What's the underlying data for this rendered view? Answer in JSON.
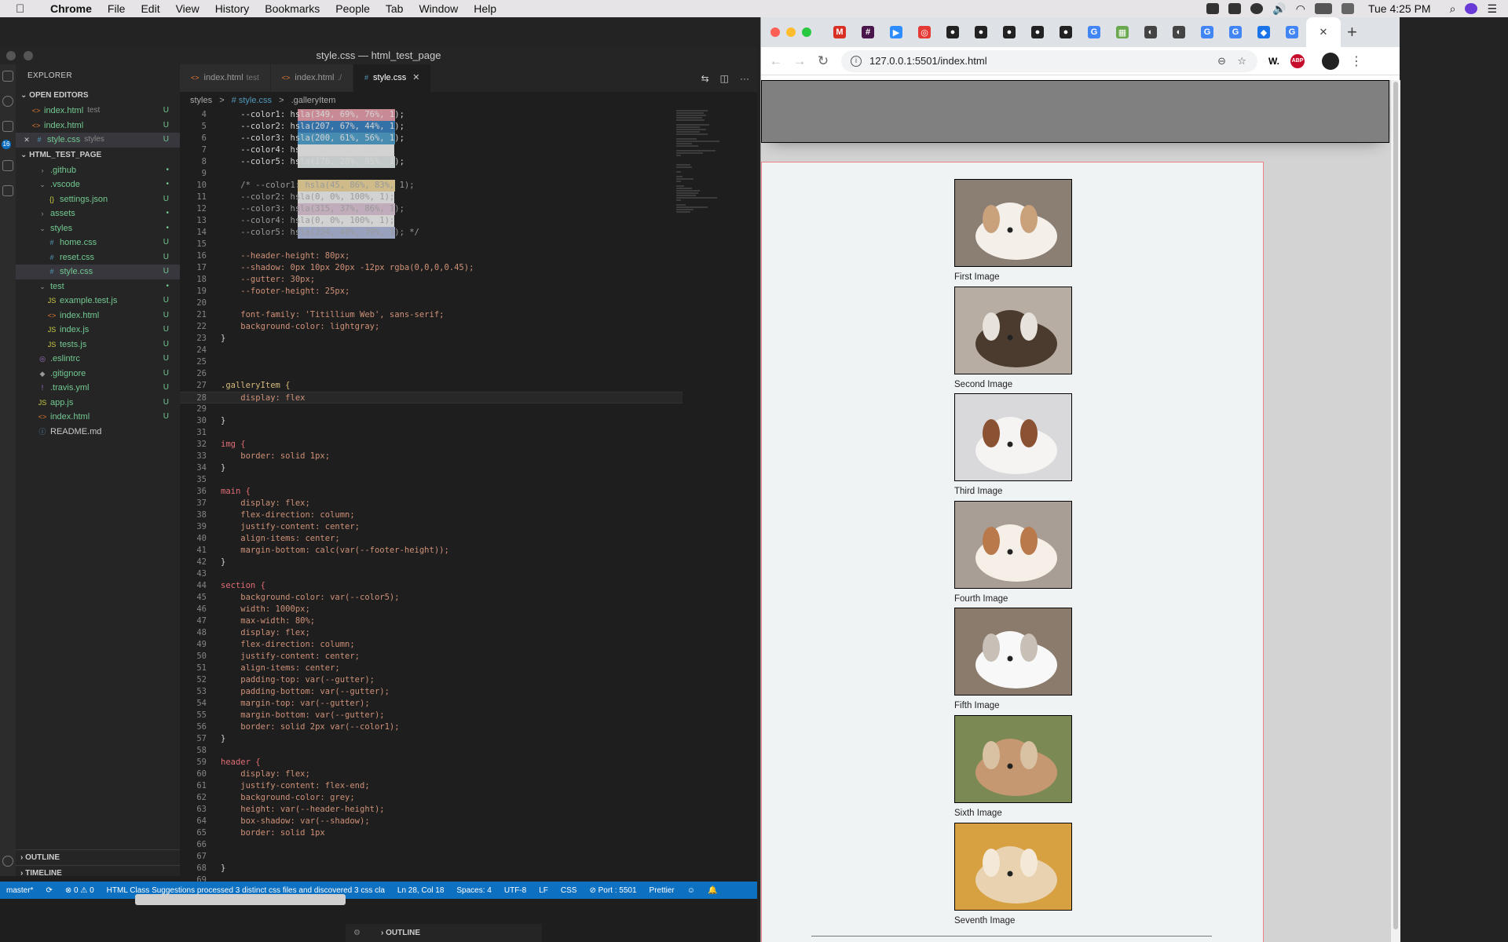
{
  "menubar": {
    "app": "Chrome",
    "items": [
      "File",
      "Edit",
      "View",
      "History",
      "Bookmarks",
      "People",
      "Tab",
      "Window",
      "Help"
    ],
    "clock": "Tue 4:25 PM"
  },
  "vscode": {
    "window_title": "style.css — html_test_page",
    "explorer_label": "EXPLORER",
    "open_editors_label": "OPEN EDITORS",
    "open_editors": [
      {
        "name": "index.html",
        "desc": "test",
        "git": "U"
      },
      {
        "name": "index.html",
        "desc": "",
        "git": "U"
      },
      {
        "name": "style.css",
        "desc": "styles",
        "git": "U"
      }
    ],
    "project_label": "HTML_TEST_PAGE",
    "tree": [
      {
        "name": ".github",
        "kind": "folder",
        "git": "•"
      },
      {
        "name": ".vscode",
        "kind": "folder-open",
        "git": "•"
      },
      {
        "name": "settings.json",
        "kind": "json",
        "git": "U"
      },
      {
        "name": "assets",
        "kind": "folder",
        "git": "•"
      },
      {
        "name": "styles",
        "kind": "folder-open",
        "git": "•"
      },
      {
        "name": "home.css",
        "kind": "css",
        "git": "U"
      },
      {
        "name": "reset.css",
        "kind": "css",
        "git": "U"
      },
      {
        "name": "style.css",
        "kind": "css",
        "git": "U"
      },
      {
        "name": "test",
        "kind": "folder-open",
        "git": "•"
      },
      {
        "name": "example.test.js",
        "kind": "js",
        "git": "U"
      },
      {
        "name": "index.html",
        "kind": "html",
        "git": "U"
      },
      {
        "name": "index.js",
        "kind": "js",
        "git": "U"
      },
      {
        "name": "tests.js",
        "kind": "js",
        "git": "U"
      },
      {
        "name": ".eslintrc",
        "kind": "eslint",
        "git": "U"
      },
      {
        "name": ".gitignore",
        "kind": "git",
        "git": "U"
      },
      {
        "name": ".travis.yml",
        "kind": "yml",
        "git": "U"
      },
      {
        "name": "app.js",
        "kind": "js",
        "git": "U"
      },
      {
        "name": "index.html",
        "kind": "html",
        "git": "U"
      },
      {
        "name": "README.md",
        "kind": "md",
        "git": ""
      }
    ],
    "outline_label": "OUTLINE",
    "timeline_label": "TIMELINE",
    "tabs": [
      {
        "name": "index.html",
        "desc": "test",
        "active": false
      },
      {
        "name": "index.html",
        "desc": "./",
        "active": false
      },
      {
        "name": "style.css",
        "desc": "",
        "active": true
      }
    ],
    "breadcrumb": [
      "styles",
      ">",
      "# style.css",
      ">",
      ".galleryItem"
    ],
    "code_lines": [
      {
        "n": "4",
        "t": "    --color1: hsla(349, 69%, 76%, 1);"
      },
      {
        "n": "5",
        "t": "    --color2: hsla(207, 67%, 44%, 1);"
      },
      {
        "n": "6",
        "t": "    --color3: hsla(200, 61%, 56%, 1);"
      },
      {
        "n": "7",
        "t": "    --color4: hsla(0, 0%, 100%, 1);"
      },
      {
        "n": "8",
        "t": "    --color5: hsla(176, 20%, 95%, 1);"
      },
      {
        "n": "9",
        "t": ""
      },
      {
        "n": "10",
        "t": "    /* --color1: hsla(45, 86%, 83%, 1);"
      },
      {
        "n": "11",
        "t": "    --color2: hsla(0, 0%, 100%, 1);"
      },
      {
        "n": "12",
        "t": "    --color3: hsla(315, 37%, 86%, 1);"
      },
      {
        "n": "13",
        "t": "    --color4: hsla(0, 0%, 100%, 1);"
      },
      {
        "n": "14",
        "t": "    --color5: hsla(224, 40%, 79%, 1); */"
      },
      {
        "n": "15",
        "t": ""
      },
      {
        "n": "16",
        "t": "    --header-height: 80px;"
      },
      {
        "n": "17",
        "t": "    --shadow: 0px 10px 20px -12px rgba(0,0,0,0.45);"
      },
      {
        "n": "18",
        "t": "    --gutter: 30px;"
      },
      {
        "n": "19",
        "t": "    --footer-height: 25px;"
      },
      {
        "n": "20",
        "t": ""
      },
      {
        "n": "21",
        "t": "    font-family: 'Titillium Web', sans-serif;"
      },
      {
        "n": "22",
        "t": "    background-color: lightgray;"
      },
      {
        "n": "23",
        "t": "}"
      },
      {
        "n": "24",
        "t": ""
      },
      {
        "n": "25",
        "t": ""
      },
      {
        "n": "26",
        "t": ""
      },
      {
        "n": "27",
        "t": ".galleryItem {"
      },
      {
        "n": "28",
        "t": "    display: flex"
      },
      {
        "n": "29",
        "t": ""
      },
      {
        "n": "30",
        "t": "}"
      },
      {
        "n": "31",
        "t": ""
      },
      {
        "n": "32",
        "t": "img {"
      },
      {
        "n": "33",
        "t": "    border: solid 1px;"
      },
      {
        "n": "34",
        "t": "}"
      },
      {
        "n": "35",
        "t": ""
      },
      {
        "n": "36",
        "t": "main {"
      },
      {
        "n": "37",
        "t": "    display: flex;"
      },
      {
        "n": "38",
        "t": "    flex-direction: column;"
      },
      {
        "n": "39",
        "t": "    justify-content: center;"
      },
      {
        "n": "40",
        "t": "    align-items: center;"
      },
      {
        "n": "41",
        "t": "    margin-bottom: calc(var(--footer-height));"
      },
      {
        "n": "42",
        "t": "}"
      },
      {
        "n": "43",
        "t": ""
      },
      {
        "n": "44",
        "t": "section {"
      },
      {
        "n": "45",
        "t": "    background-color: var(--color5);"
      },
      {
        "n": "46",
        "t": "    width: 1000px;"
      },
      {
        "n": "47",
        "t": "    max-width: 80%;"
      },
      {
        "n": "48",
        "t": "    display: flex;"
      },
      {
        "n": "49",
        "t": "    flex-direction: column;"
      },
      {
        "n": "50",
        "t": "    justify-content: center;"
      },
      {
        "n": "51",
        "t": "    align-items: center;"
      },
      {
        "n": "52",
        "t": "    padding-top: var(--gutter);"
      },
      {
        "n": "53",
        "t": "    padding-bottom: var(--gutter);"
      },
      {
        "n": "54",
        "t": "    margin-top: var(--gutter);"
      },
      {
        "n": "55",
        "t": "    margin-bottom: var(--gutter);"
      },
      {
        "n": "56",
        "t": "    border: solid 2px var(--color1);"
      },
      {
        "n": "57",
        "t": "}"
      },
      {
        "n": "58",
        "t": ""
      },
      {
        "n": "59",
        "t": "header {"
      },
      {
        "n": "60",
        "t": "    display: flex;"
      },
      {
        "n": "61",
        "t": "    justify-content: flex-end;"
      },
      {
        "n": "62",
        "t": "    background-color: grey;"
      },
      {
        "n": "63",
        "t": "    height: var(--header-height);"
      },
      {
        "n": "64",
        "t": "    box-shadow: var(--shadow);"
      },
      {
        "n": "65",
        "t": "    border: solid 1px"
      },
      {
        "n": "66",
        "t": ""
      },
      {
        "n": "67",
        "t": ""
      },
      {
        "n": "68",
        "t": "}"
      },
      {
        "n": "69",
        "t": ""
      }
    ],
    "current_line": "28",
    "status": {
      "branch": "master*",
      "sync": "⟳",
      "problems": "⊗ 0 ⚠ 0",
      "message": "HTML Class Suggestions processed 3 distinct css files and discovered 3 css cla",
      "position": "Ln 28, Col 18",
      "spaces": "Spaces: 4",
      "encoding": "UTF-8",
      "eol": "LF",
      "language": "CSS",
      "port": "⊘ Port : 5501",
      "prettier": "Prettier"
    },
    "lower_panel_label": "OUTLINE"
  },
  "chrome": {
    "url": "127.0.0.1:5501/index.html",
    "extension_w": "W.",
    "extension_abp": "ABP",
    "tab_icons": [
      {
        "name": "gmail-icon",
        "glyph": "M",
        "color": "#d93025"
      },
      {
        "name": "slack-icon",
        "glyph": "#",
        "color": "#4a154b"
      },
      {
        "name": "zoom-icon",
        "glyph": "▶",
        "color": "#2d8cff"
      },
      {
        "name": "lifesaver-icon",
        "glyph": "◎",
        "color": "#e53935"
      },
      {
        "name": "github-icon",
        "glyph": "●",
        "color": "#222222"
      },
      {
        "name": "github-icon",
        "glyph": "●",
        "color": "#222222"
      },
      {
        "name": "github-icon",
        "glyph": "●",
        "color": "#222222"
      },
      {
        "name": "github-icon",
        "glyph": "●",
        "color": "#222222"
      },
      {
        "name": "github-icon",
        "glyph": "●",
        "color": "#222222"
      },
      {
        "name": "google-icon",
        "glyph": "G",
        "color": "#4285f4"
      },
      {
        "name": "maps-icon",
        "glyph": "▦",
        "color": "#6aa84f"
      },
      {
        "name": "globe-icon",
        "glyph": "◐",
        "color": "#444444"
      },
      {
        "name": "globe-icon",
        "glyph": "◐",
        "color": "#444444"
      },
      {
        "name": "google-icon",
        "glyph": "G",
        "color": "#4285f4"
      },
      {
        "name": "google-icon",
        "glyph": "G",
        "color": "#4285f4"
      },
      {
        "name": "scholar-icon",
        "glyph": "◆",
        "color": "#1a73e8"
      },
      {
        "name": "google-icon",
        "glyph": "G",
        "color": "#4285f4"
      }
    ],
    "gallery": [
      {
        "caption": "First Image",
        "palette": [
          "#8b7f74",
          "#c9a27c",
          "#f4efe9"
        ]
      },
      {
        "caption": "Second Image",
        "palette": [
          "#b8ada3",
          "#e7e2dc",
          "#4b3b2f"
        ]
      },
      {
        "caption": "Third Image",
        "palette": [
          "#d9d9dc",
          "#8a5132",
          "#f6f4f2"
        ]
      },
      {
        "caption": "Fourth Image",
        "palette": [
          "#a89e95",
          "#b9794a",
          "#f5efe8"
        ]
      },
      {
        "caption": "Fifth Image",
        "palette": [
          "#8a7b6c",
          "#c8bfb6",
          "#f8f8f8"
        ]
      },
      {
        "caption": "Sixth Image",
        "palette": [
          "#7b8a54",
          "#d9c2a4",
          "#c69871"
        ]
      },
      {
        "caption": "Seventh Image",
        "palette": [
          "#d7a040",
          "#f4e9d9",
          "#e8d2b0"
        ]
      }
    ]
  }
}
